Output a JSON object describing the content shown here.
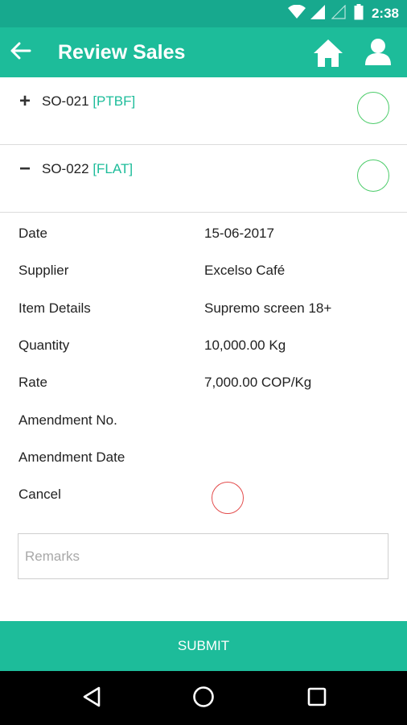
{
  "status_bar": {
    "time": "2:38",
    "icons": [
      "wifi-icon",
      "cell-signal-icon",
      "cell-signal-empty-icon",
      "battery-icon"
    ]
  },
  "app_bar": {
    "title": "Review Sales",
    "icons": [
      "back-arrow-icon",
      "home-icon",
      "profile-icon"
    ]
  },
  "orders": [
    {
      "toggle": "+",
      "code": "SO-021",
      "type": "[PTBF]",
      "expanded": false,
      "accent": "#1dbc9a"
    },
    {
      "toggle": "−",
      "code": "SO-022",
      "type": "[FLAT]",
      "expanded": true,
      "accent": "#1dbc9a"
    }
  ],
  "details": [
    {
      "label": "Date",
      "value": "15-06-2017"
    },
    {
      "label": "Supplier",
      "value": "Excelso Café"
    },
    {
      "label": "Item Details",
      "value": "Supremo screen 18+"
    },
    {
      "label": "Quantity",
      "value": "10,000.00 Kg"
    },
    {
      "label": "Rate",
      "value": "7,000.00 COP/Kg"
    },
    {
      "label": "Amendment No.",
      "value": ""
    },
    {
      "label": "Amendment Date",
      "value": ""
    },
    {
      "label": "Cancel",
      "value": ""
    }
  ],
  "remarks": {
    "placeholder": "Remarks",
    "value": ""
  },
  "submit_label": "SUBMIT",
  "colors": {
    "primary": "#1dbc9a",
    "status_bar": "#17a98e",
    "approve_circle": "#4ccc6a",
    "cancel_circle": "#e34b4b"
  },
  "nav_bar": {
    "icons": [
      "back-triangle-icon",
      "home-circle-icon",
      "recents-square-icon"
    ]
  }
}
